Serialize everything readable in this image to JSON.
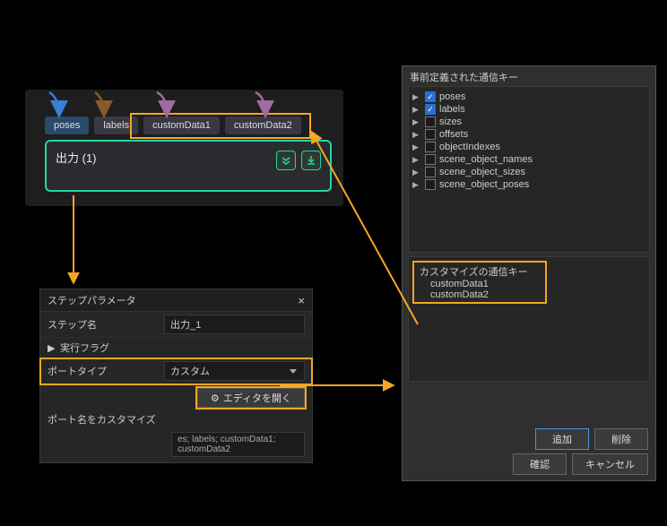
{
  "node": {
    "tabs": [
      "poses",
      "labels",
      "customData1",
      "customData2"
    ],
    "title": "出力 (1)"
  },
  "params": {
    "panelTitle": "ステップパラメータ",
    "stepNameLabel": "ステップ名",
    "stepNameValue": "出力_1",
    "execFlagLabel": "実行フラグ",
    "portTypeLabel": "ポートタイプ",
    "portTypeValue": "カスタム",
    "editorBtn": "エディタを開く",
    "customizeLabel": "ポート名をカスタマイズ",
    "customizeValue": "es; labels; customData1; customData2"
  },
  "dialog": {
    "predefLabel": "事前定義された通信キー",
    "tree": [
      {
        "label": "poses",
        "checked": true
      },
      {
        "label": "labels",
        "checked": true
      },
      {
        "label": "sizes",
        "checked": false
      },
      {
        "label": "offsets",
        "checked": false
      },
      {
        "label": "objectIndexes",
        "checked": false
      },
      {
        "label": "scene_object_names",
        "checked": false
      },
      {
        "label": "scene_object_sizes",
        "checked": false
      },
      {
        "label": "scene_object_poses",
        "checked": false
      }
    ],
    "customLabel": "カスタマイズの通信キー",
    "customItems": [
      "customData1",
      "customData2"
    ],
    "buttons": {
      "add": "追加",
      "delete": "削除",
      "confirm": "確認",
      "cancel": "キャンセル"
    }
  }
}
